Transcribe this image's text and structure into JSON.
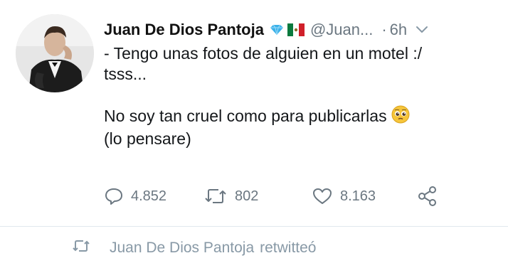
{
  "tweet": {
    "author_name": "Juan De Dios Pantoja",
    "handle": "@Juan...",
    "separator": "·",
    "time": "6h",
    "text_lines": [
      "- Tengo unas fotos de alguien en un motel :/",
      "tsss...",
      "",
      "No soy tan cruel como para publicarlas",
      "(lo pensare)"
    ],
    "emoji": "pleading-face-emoji",
    "actions": {
      "replies": "4.852",
      "retweets": "802",
      "likes": "8.163"
    }
  },
  "retweet_context": {
    "author_name": "Juan De Dios Pantoja",
    "label": "retwitteó"
  },
  "icons": [
    "avatar-photo",
    "verified-diamond-icon",
    "mexico-flag-icon",
    "chevron-down-icon",
    "reply-icon",
    "retweet-icon",
    "like-icon",
    "share-icon"
  ],
  "colors": {
    "text": "#14171a",
    "muted": "#6b7781",
    "badge": "#3ab0e8",
    "divider": "#e1e8ed"
  }
}
